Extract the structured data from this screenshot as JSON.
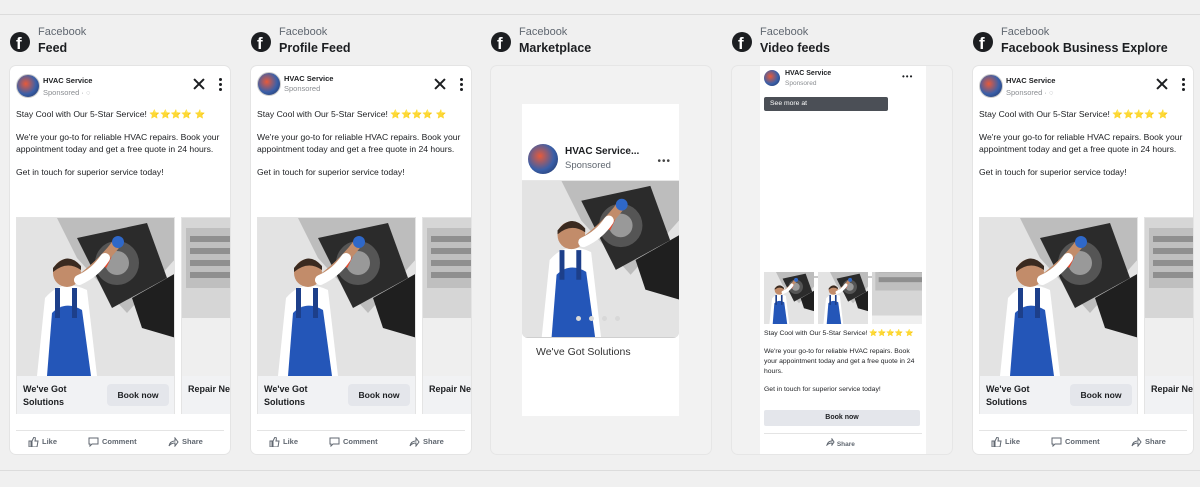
{
  "platform": "Facebook",
  "colors": {
    "star": "#f2cc35",
    "overall": "#1c1e21",
    "workwear": "#2456b8"
  },
  "ad": {
    "advertiser": "HVAC Service",
    "sponsored": "Sponsored",
    "intro": "Stay Cool with Our 5-Star Service! ⭐⭐⭐⭐ ⭐",
    "intro_text": "Stay Cool with Our 5-Star Service!",
    "stars": "⭐⭐⭐⭐ ⭐",
    "body": "We're your go-to for reliable HVAC repairs. Book your appointment today and get a free quote in 24 hours.",
    "closing": "Get in touch for superior service today!",
    "card1_headline": "We've Got Solutions",
    "card2_headline_partial": "Repair Nearby",
    "cta": "Book now"
  },
  "placements": [
    {
      "name": "Feed"
    },
    {
      "name": "Profile Feed"
    },
    {
      "name": "Marketplace"
    },
    {
      "name": "Video feeds"
    },
    {
      "name": "Facebook Business Explore"
    }
  ],
  "actions": {
    "like": "Like",
    "comment": "Comment",
    "share": "Share"
  },
  "marketplace": {
    "title": "HVAC Service...",
    "sponsored": "Sponsored",
    "headline": "We've Got Solutions"
  },
  "video": {
    "see_more": "See more at",
    "stars": "⭐⭐⭐⭐ ⭐"
  }
}
